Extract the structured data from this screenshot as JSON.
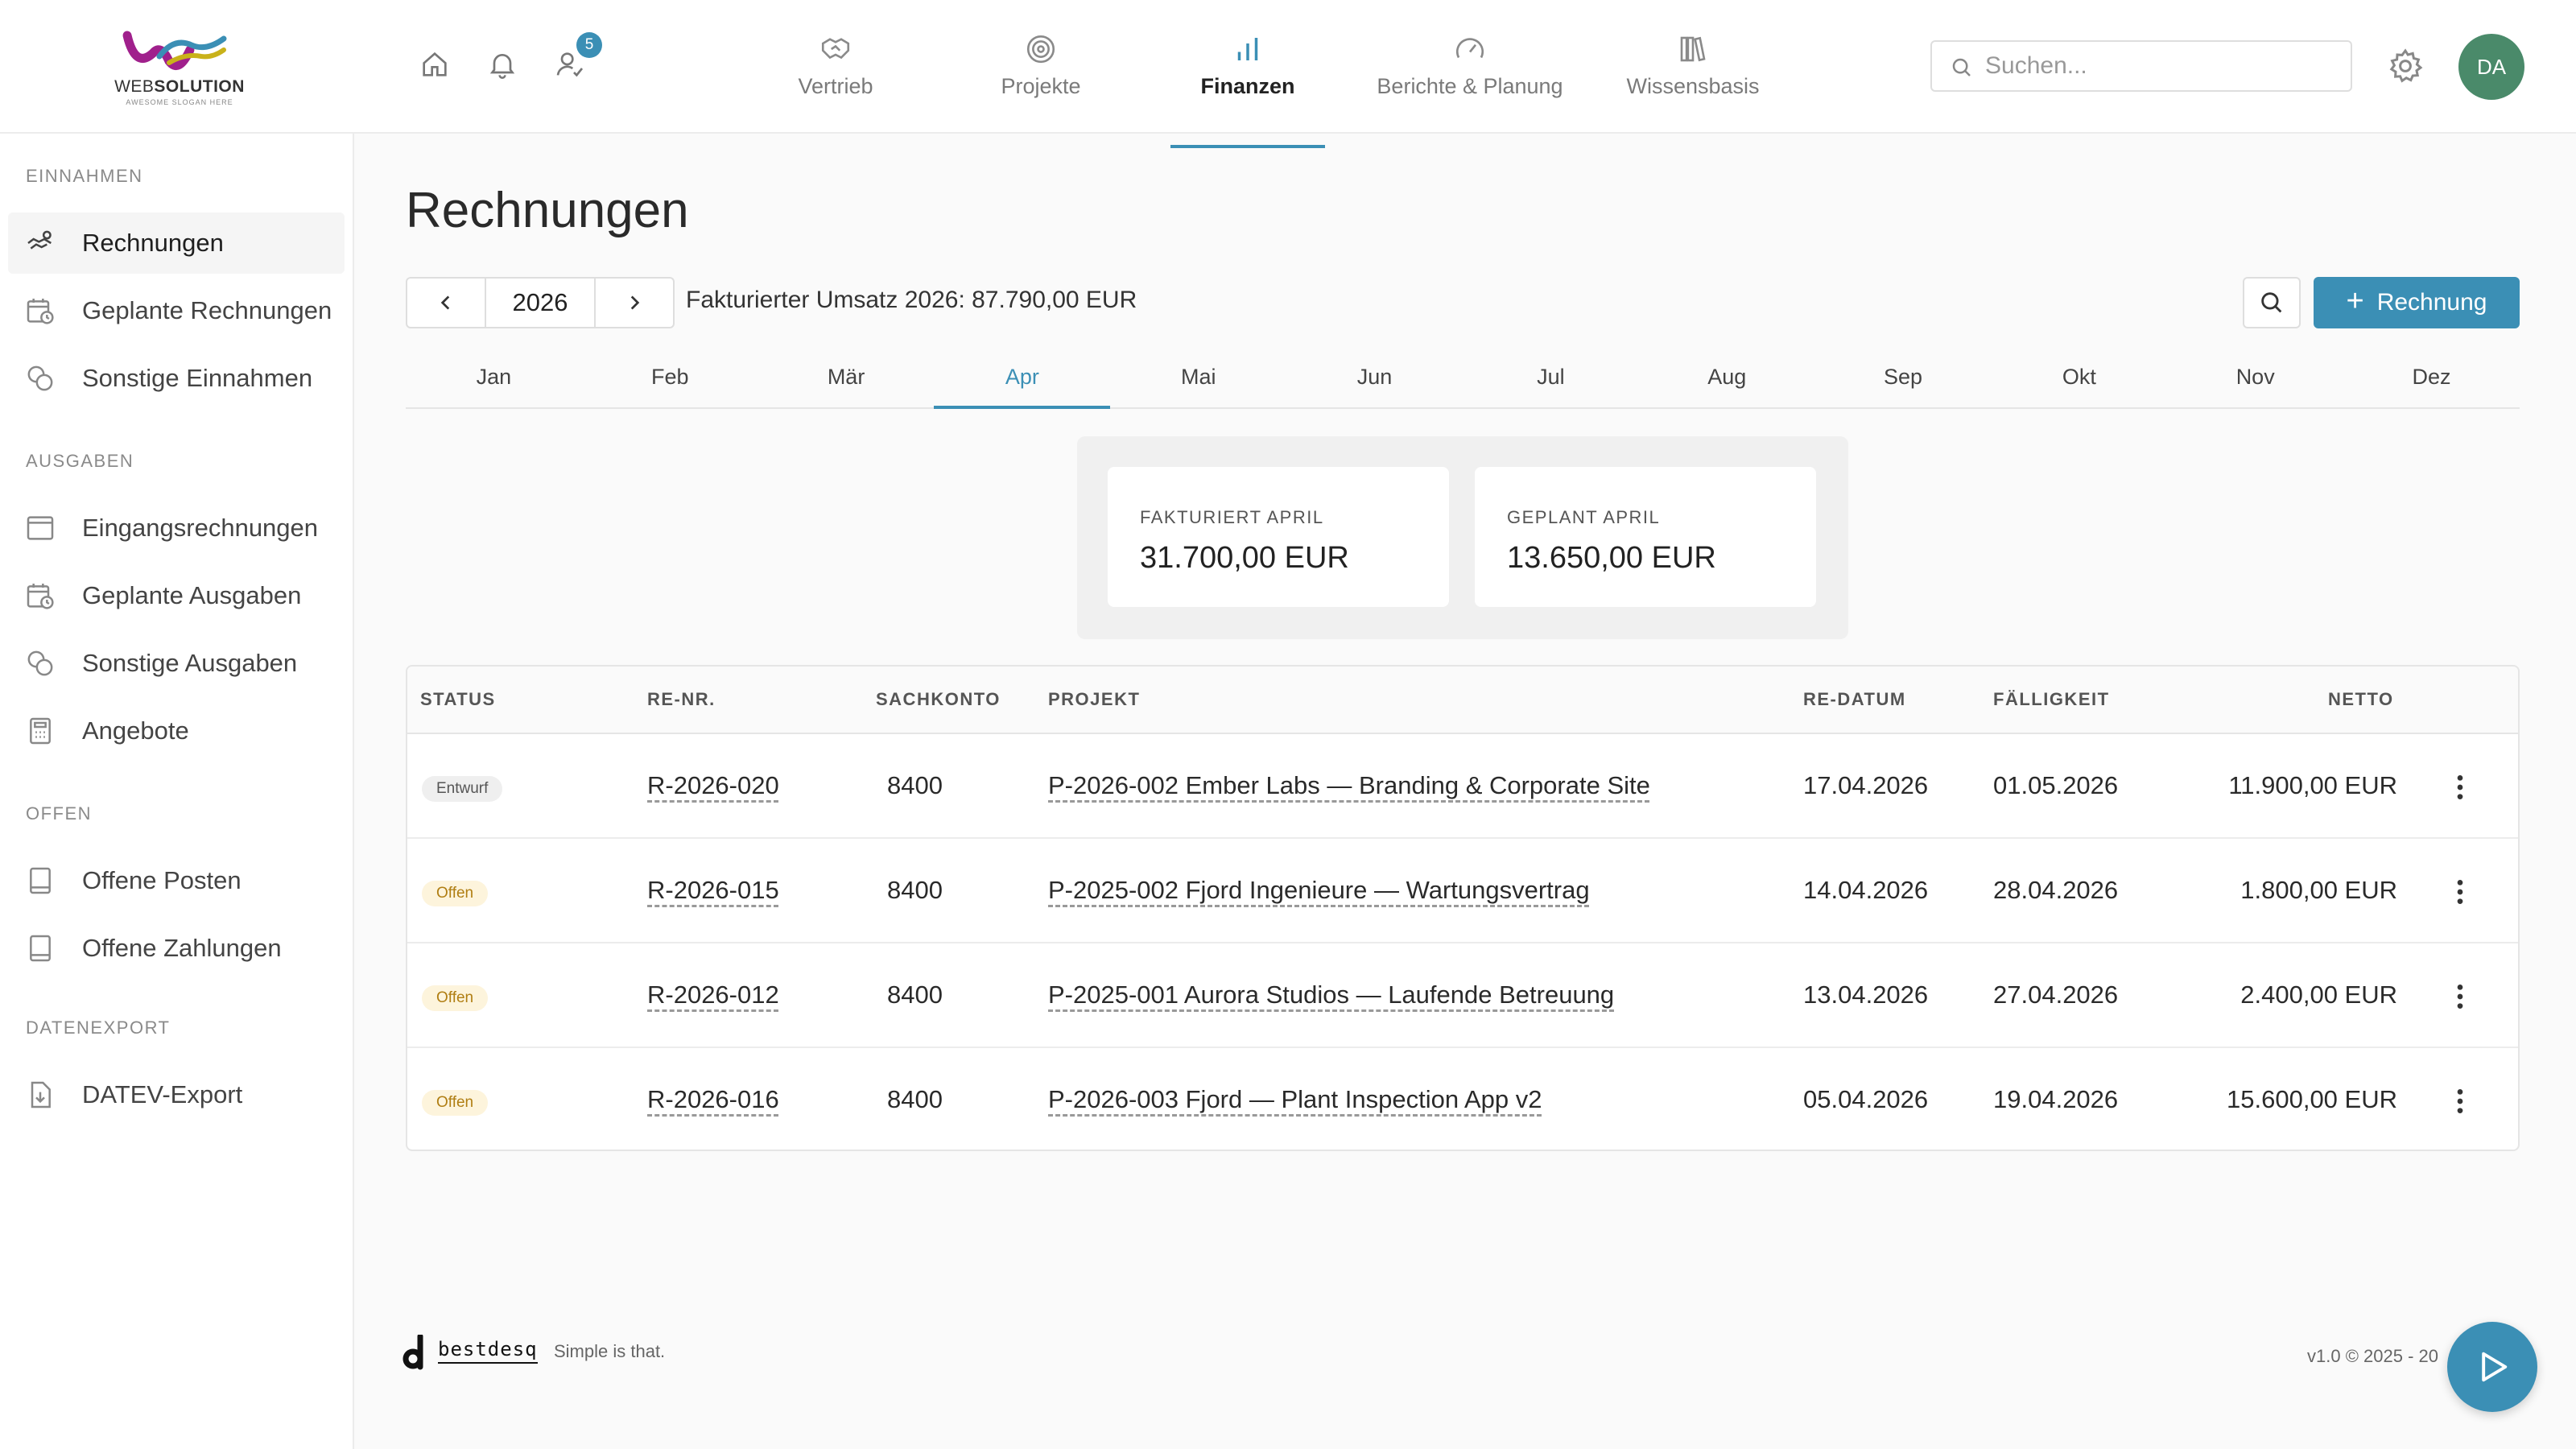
{
  "brand": {
    "logo_word_light": "WEB",
    "logo_word_bold": "SOLUTION",
    "logo_tagline": "AWESOME SLOGAN HERE",
    "colors": {
      "accent": "#3b8fb5",
      "avatar": "#4a8a6a",
      "open_badge_bg": "#fdf4dc",
      "open_badge_fg": "#b07e12"
    }
  },
  "topbar": {
    "icons": [
      "home-icon",
      "bell-icon",
      "user-check-icon"
    ],
    "notification_count": "5",
    "nav": [
      {
        "label": "Vertrieb",
        "icon": "handshake-icon",
        "active": false
      },
      {
        "label": "Projekte",
        "icon": "target-icon",
        "active": false
      },
      {
        "label": "Finanzen",
        "icon": "bar-chart-icon",
        "active": true
      },
      {
        "label": "Berichte & Planung",
        "icon": "gauge-icon",
        "active": false
      },
      {
        "label": "Wissensbasis",
        "icon": "books-icon",
        "active": false
      }
    ],
    "search_placeholder": "Suchen...",
    "avatar_initials": "DA"
  },
  "sidebar": {
    "sections": [
      {
        "title": "EINNAHMEN",
        "items": [
          {
            "label": "Rechnungen",
            "icon": "handshake-money-icon",
            "active": true
          },
          {
            "label": "Geplante Rechnungen",
            "icon": "calendar-clock-icon",
            "active": false
          },
          {
            "label": "Sonstige Einnahmen",
            "icon": "coins-icon",
            "active": false
          }
        ]
      },
      {
        "title": "AUSGABEN",
        "items": [
          {
            "label": "Eingangsrechnungen",
            "icon": "inbox-icon",
            "active": false
          },
          {
            "label": "Geplante Ausgaben",
            "icon": "calendar-clock-icon",
            "active": false
          },
          {
            "label": "Sonstige Ausgaben",
            "icon": "coins-icon",
            "active": false
          },
          {
            "label": "Angebote",
            "icon": "calculator-icon",
            "active": false
          }
        ]
      },
      {
        "title": "OFFEN",
        "items": [
          {
            "label": "Offene Posten",
            "icon": "ledger-icon",
            "active": false
          },
          {
            "label": "Offene Zahlungen",
            "icon": "ledger-icon",
            "active": false
          }
        ]
      },
      {
        "title": "DATENEXPORT",
        "items": [
          {
            "label": "DATEV-Export",
            "icon": "file-download-icon",
            "active": false
          }
        ]
      }
    ]
  },
  "main": {
    "title": "Rechnungen",
    "year": "2026",
    "revenue_text": "Fakturierter Umsatz 2026: 87.790,00 EUR",
    "new_button_label": "Rechnung",
    "months": [
      "Jan",
      "Feb",
      "Mär",
      "Apr",
      "Mai",
      "Jun",
      "Jul",
      "Aug",
      "Sep",
      "Okt",
      "Nov",
      "Dez"
    ],
    "active_month": "Apr",
    "kpis": [
      {
        "label": "FAKTURIERT APRIL",
        "value": "31.700,00 EUR"
      },
      {
        "label": "GEPLANT APRIL",
        "value": "13.650,00 EUR"
      }
    ],
    "table": {
      "columns": [
        "STATUS",
        "RE-NR.",
        "SACHKONTO",
        "PROJEKT",
        "RE-DATUM",
        "FÄLLIGKEIT",
        "NETTO"
      ],
      "rows": [
        {
          "status": "Entwurf",
          "status_kind": "draft",
          "number": "R-2026-020",
          "account": "8400",
          "project": "P-2026-002 Ember Labs — Branding & Corporate Site",
          "date": "17.04.2026",
          "due": "01.05.2026",
          "net": "11.900,00 EUR"
        },
        {
          "status": "Offen",
          "status_kind": "open",
          "number": "R-2026-015",
          "account": "8400",
          "project": "P-2025-002 Fjord Ingenieure — Wartungsvertrag",
          "date": "14.04.2026",
          "due": "28.04.2026",
          "net": "1.800,00 EUR"
        },
        {
          "status": "Offen",
          "status_kind": "open",
          "number": "R-2026-012",
          "account": "8400",
          "project": "P-2025-001 Aurora Studios — Laufende Betreuung",
          "date": "13.04.2026",
          "due": "27.04.2026",
          "net": "2.400,00 EUR"
        },
        {
          "status": "Offen",
          "status_kind": "open",
          "number": "R-2026-016",
          "account": "8400",
          "project": "P-2026-003 Fjord — Plant Inspection App v2",
          "date": "05.04.2026",
          "due": "19.04.2026",
          "net": "15.600,00 EUR"
        }
      ]
    }
  },
  "footer": {
    "brand": "bestdesq",
    "tagline": "Simple is that.",
    "version": "v1.0 © 2025 - 20"
  }
}
